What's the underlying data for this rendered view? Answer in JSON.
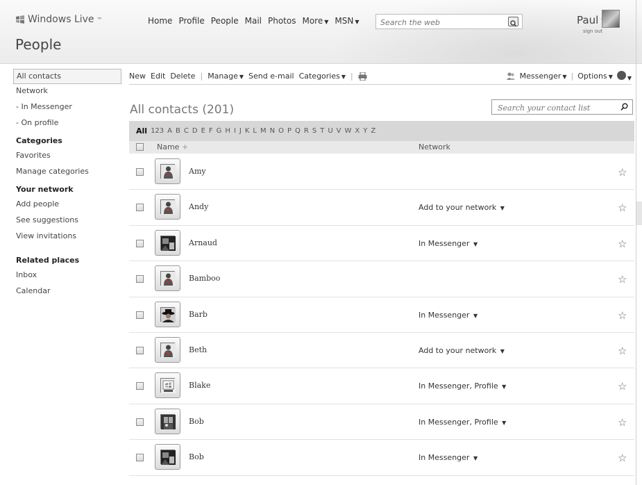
{
  "header": {
    "brand": "Windows Live",
    "brand_tm": "™",
    "page_title": "People",
    "nav": [
      {
        "label": "Home",
        "dropdown": false
      },
      {
        "label": "Profile",
        "dropdown": false
      },
      {
        "label": "People",
        "dropdown": false
      },
      {
        "label": "Mail",
        "dropdown": false
      },
      {
        "label": "Photos",
        "dropdown": false
      },
      {
        "label": "More",
        "dropdown": true
      },
      {
        "label": "MSN",
        "dropdown": true
      }
    ],
    "search_placeholder": "Search the web",
    "user_name": "Paul",
    "sign_out": "sign out"
  },
  "sidebar": {
    "items": [
      {
        "label": "All contacts",
        "type": "item",
        "selected": true
      },
      {
        "label": "Network",
        "type": "item"
      },
      {
        "label": "- In Messenger",
        "type": "item"
      },
      {
        "label": "- On profile",
        "type": "item"
      },
      {
        "label": "Categories",
        "type": "heading"
      },
      {
        "label": "Favorites",
        "type": "item"
      },
      {
        "label": "Manage categories",
        "type": "item"
      },
      {
        "label": "Your network",
        "type": "heading"
      },
      {
        "label": "Add people",
        "type": "item"
      },
      {
        "label": "See suggestions",
        "type": "item"
      },
      {
        "label": "View invitations",
        "type": "item"
      },
      {
        "label": "Related places",
        "type": "heading"
      },
      {
        "label": "Inbox",
        "type": "item"
      },
      {
        "label": "Calendar",
        "type": "item"
      }
    ]
  },
  "toolbar": {
    "new": "New",
    "edit": "Edit",
    "delete": "Delete",
    "manage": "Manage",
    "send_email": "Send e-mail",
    "categories": "Categories",
    "messenger": "Messenger",
    "options": "Options"
  },
  "contacts": {
    "title": "All contacts (201)",
    "search_placeholder": "Search your contact list",
    "alpha": [
      "All",
      "123",
      "A",
      "B",
      "C",
      "D",
      "E",
      "F",
      "G",
      "H",
      "I",
      "J",
      "K",
      "L",
      "M",
      "N",
      "O",
      "P",
      "Q",
      "R",
      "S",
      "T",
      "U",
      "V",
      "W",
      "X",
      "Y",
      "Z"
    ],
    "col_name": "Name",
    "col_name_sort": "+",
    "col_network": "Network",
    "rows": [
      {
        "name": "Amy",
        "network": "",
        "avatar": "default-person"
      },
      {
        "name": "Andy",
        "network": "Add to your network",
        "avatar": "default-person"
      },
      {
        "name": "Arnaud",
        "network": "In Messenger",
        "avatar": "photo-dark"
      },
      {
        "name": "Bamboo",
        "network": "",
        "avatar": "default-person"
      },
      {
        "name": "Barb",
        "network": "In Messenger",
        "avatar": "photo-hat"
      },
      {
        "name": "Beth",
        "network": "Add to your network",
        "avatar": "default-person"
      },
      {
        "name": "Blake",
        "network": "In Messenger, Profile",
        "avatar": "windows-logo"
      },
      {
        "name": "Bob",
        "network": "In Messenger, Profile",
        "avatar": "photo-window"
      },
      {
        "name": "Bob",
        "network": "In Messenger",
        "avatar": "photo-dark"
      }
    ]
  },
  "colors": {
    "alpha_bar_bg": "#d7d7d7",
    "header_bg": "#f1f1f1",
    "row_divider": "#e2e2e2"
  }
}
